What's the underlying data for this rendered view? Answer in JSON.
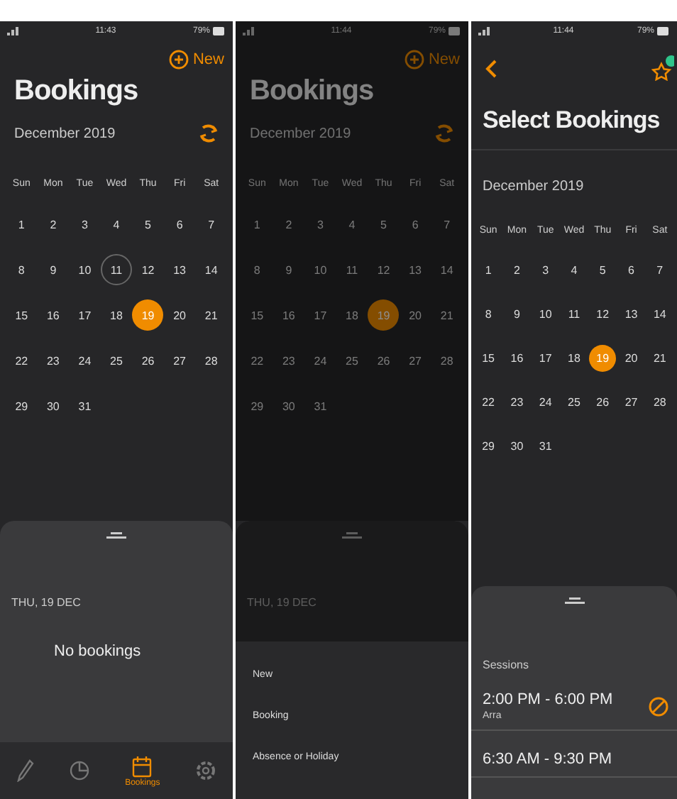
{
  "screens": [
    {
      "kind": "bookings",
      "dimmed": false,
      "status": {
        "time": "11:43",
        "battery": "79%"
      },
      "new_button": "New",
      "title": "Bookings",
      "month": "December 2019",
      "weekdays": [
        "Sun",
        "Mon",
        "Tue",
        "Wed",
        "Thu",
        "Fri",
        "Sat"
      ],
      "days": [
        {
          "label": "1",
          "selected": false,
          "outlined": false
        },
        {
          "label": "2",
          "selected": false,
          "outlined": false
        },
        {
          "label": "3",
          "selected": false,
          "outlined": false
        },
        {
          "label": "4",
          "selected": false,
          "outlined": false
        },
        {
          "label": "5",
          "selected": false,
          "outlined": false
        },
        {
          "label": "6",
          "selected": false,
          "outlined": false
        },
        {
          "label": "7",
          "selected": false,
          "outlined": false
        },
        {
          "label": "8",
          "selected": false,
          "outlined": false
        },
        {
          "label": "9",
          "selected": false,
          "outlined": false
        },
        {
          "label": "10",
          "selected": false,
          "outlined": false
        },
        {
          "label": "11",
          "selected": false,
          "outlined": true
        },
        {
          "label": "12",
          "selected": false,
          "outlined": false
        },
        {
          "label": "13",
          "selected": false,
          "outlined": false
        },
        {
          "label": "14",
          "selected": false,
          "outlined": false
        },
        {
          "label": "15",
          "selected": false,
          "outlined": false
        },
        {
          "label": "16",
          "selected": false,
          "outlined": false
        },
        {
          "label": "17",
          "selected": false,
          "outlined": false
        },
        {
          "label": "18",
          "selected": false,
          "outlined": false
        },
        {
          "label": "19",
          "selected": true,
          "outlined": false
        },
        {
          "label": "20",
          "selected": false,
          "outlined": false
        },
        {
          "label": "21",
          "selected": false,
          "outlined": false
        },
        {
          "label": "22",
          "selected": false,
          "outlined": false
        },
        {
          "label": "23",
          "selected": false,
          "outlined": false
        },
        {
          "label": "24",
          "selected": false,
          "outlined": false
        },
        {
          "label": "25",
          "selected": false,
          "outlined": false
        },
        {
          "label": "26",
          "selected": false,
          "outlined": false
        },
        {
          "label": "27",
          "selected": false,
          "outlined": false
        },
        {
          "label": "28",
          "selected": false,
          "outlined": false
        },
        {
          "label": "29",
          "selected": false,
          "outlined": false
        },
        {
          "label": "30",
          "selected": false,
          "outlined": false
        },
        {
          "label": "31",
          "selected": false,
          "outlined": false
        }
      ],
      "sheet": {
        "date": "THU, 19 DEC",
        "empty_text": "No bookings"
      },
      "tab_bar": [
        {
          "kind": "pen",
          "selected": false
        },
        {
          "kind": "chart",
          "selected": false
        },
        {
          "kind": "calendar",
          "label": "Bookings",
          "selected": true
        },
        {
          "kind": "settings",
          "selected": false
        }
      ]
    },
    {
      "kind": "bookings",
      "dimmed": true,
      "status": {
        "time": "11:44",
        "battery": "79%"
      },
      "new_button": "New",
      "title": "Bookings",
      "month": "December 2019",
      "weekdays": [
        "Sun",
        "Mon",
        "Tue",
        "Wed",
        "Thu",
        "Fri",
        "Sat"
      ],
      "days": [
        {
          "label": "1",
          "selected": false,
          "outlined": false
        },
        {
          "label": "2",
          "selected": false,
          "outlined": false
        },
        {
          "label": "3",
          "selected": false,
          "outlined": false
        },
        {
          "label": "4",
          "selected": false,
          "outlined": false
        },
        {
          "label": "5",
          "selected": false,
          "outlined": false
        },
        {
          "label": "6",
          "selected": false,
          "outlined": false
        },
        {
          "label": "7",
          "selected": false,
          "outlined": false
        },
        {
          "label": "8",
          "selected": false,
          "outlined": false
        },
        {
          "label": "9",
          "selected": false,
          "outlined": false
        },
        {
          "label": "10",
          "selected": false,
          "outlined": false
        },
        {
          "label": "11",
          "selected": false,
          "outlined": false
        },
        {
          "label": "12",
          "selected": false,
          "outlined": false
        },
        {
          "label": "13",
          "selected": false,
          "outlined": false
        },
        {
          "label": "14",
          "selected": false,
          "outlined": false
        },
        {
          "label": "15",
          "selected": false,
          "outlined": false
        },
        {
          "label": "16",
          "selected": false,
          "outlined": false
        },
        {
          "label": "17",
          "selected": false,
          "outlined": false
        },
        {
          "label": "18",
          "selected": false,
          "outlined": false
        },
        {
          "label": "19",
          "selected": true,
          "outlined": false
        },
        {
          "label": "20",
          "selected": false,
          "outlined": false
        },
        {
          "label": "21",
          "selected": false,
          "outlined": false
        },
        {
          "label": "22",
          "selected": false,
          "outlined": false
        },
        {
          "label": "23",
          "selected": false,
          "outlined": false
        },
        {
          "label": "24",
          "selected": false,
          "outlined": false
        },
        {
          "label": "25",
          "selected": false,
          "outlined": false
        },
        {
          "label": "26",
          "selected": false,
          "outlined": false
        },
        {
          "label": "27",
          "selected": false,
          "outlined": false
        },
        {
          "label": "28",
          "selected": false,
          "outlined": false
        },
        {
          "label": "29",
          "selected": false,
          "outlined": false
        },
        {
          "label": "30",
          "selected": false,
          "outlined": false
        },
        {
          "label": "31",
          "selected": false,
          "outlined": false
        }
      ],
      "sheet": {
        "date": "THU, 19 DEC"
      },
      "action_sheet": [
        "New",
        "Booking",
        "Absence or Holiday"
      ]
    },
    {
      "kind": "select",
      "dimmed": false,
      "status": {
        "time": "11:44",
        "battery": "79%"
      },
      "title": "Select Bookings",
      "month": "December 2019",
      "weekdays": [
        "Sun",
        "Mon",
        "Tue",
        "Wed",
        "Thu",
        "Fri",
        "Sat"
      ],
      "days": [
        {
          "label": "1",
          "selected": false,
          "outlined": false
        },
        {
          "label": "2",
          "selected": false,
          "outlined": false
        },
        {
          "label": "3",
          "selected": false,
          "outlined": false
        },
        {
          "label": "4",
          "selected": false,
          "outlined": false
        },
        {
          "label": "5",
          "selected": false,
          "outlined": false
        },
        {
          "label": "6",
          "selected": false,
          "outlined": false
        },
        {
          "label": "7",
          "selected": false,
          "outlined": false
        },
        {
          "label": "8",
          "selected": false,
          "outlined": false
        },
        {
          "label": "9",
          "selected": false,
          "outlined": false
        },
        {
          "label": "10",
          "selected": false,
          "outlined": false
        },
        {
          "label": "11",
          "selected": false,
          "outlined": false
        },
        {
          "label": "12",
          "selected": false,
          "outlined": false
        },
        {
          "label": "13",
          "selected": false,
          "outlined": false
        },
        {
          "label": "14",
          "selected": false,
          "outlined": false
        },
        {
          "label": "15",
          "selected": false,
          "outlined": false
        },
        {
          "label": "16",
          "selected": false,
          "outlined": false
        },
        {
          "label": "17",
          "selected": false,
          "outlined": false
        },
        {
          "label": "18",
          "selected": false,
          "outlined": false
        },
        {
          "label": "19",
          "selected": true,
          "outlined": false
        },
        {
          "label": "20",
          "selected": false,
          "outlined": false
        },
        {
          "label": "21",
          "selected": false,
          "outlined": false
        },
        {
          "label": "22",
          "selected": false,
          "outlined": false
        },
        {
          "label": "23",
          "selected": false,
          "outlined": false
        },
        {
          "label": "24",
          "selected": false,
          "outlined": false
        },
        {
          "label": "25",
          "selected": false,
          "outlined": false
        },
        {
          "label": "26",
          "selected": false,
          "outlined": false
        },
        {
          "label": "27",
          "selected": false,
          "outlined": false
        },
        {
          "label": "28",
          "selected": false,
          "outlined": false
        },
        {
          "label": "29",
          "selected": false,
          "outlined": false
        },
        {
          "label": "30",
          "selected": false,
          "outlined": false
        },
        {
          "label": "31",
          "selected": false,
          "outlined": false
        }
      ],
      "sheet": {
        "section": "Sessions",
        "sessions": [
          {
            "time": "2:00 PM - 6:00 PM",
            "name": "Arra"
          },
          {
            "time": "6:30 AM - 9:30 PM"
          }
        ]
      }
    }
  ]
}
